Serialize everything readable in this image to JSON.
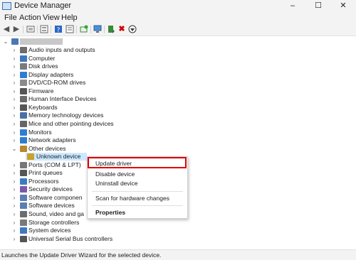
{
  "window": {
    "title": "Device Manager",
    "controls": {
      "minimize": "–",
      "maximize": "☐",
      "close": "✕"
    }
  },
  "menu": [
    "File",
    "Action",
    "View",
    "Help"
  ],
  "toolbar_icons": [
    "back-icon",
    "forward-icon",
    "properties-icon",
    "show-hidden-icon",
    "help-icon",
    "view-icon",
    "refresh-icon",
    "monitor-icon",
    "add-driver-icon",
    "uninstall-icon",
    "download-icon"
  ],
  "tree": {
    "root_label": "",
    "items": [
      {
        "label": "Audio inputs and outputs",
        "icon": "audio",
        "expanded": false
      },
      {
        "label": "Computer",
        "icon": "computer",
        "expanded": false
      },
      {
        "label": "Disk drives",
        "icon": "disk",
        "expanded": false
      },
      {
        "label": "Display adapters",
        "icon": "display",
        "expanded": false
      },
      {
        "label": "DVD/CD-ROM drives",
        "icon": "dvd",
        "expanded": false
      },
      {
        "label": "Firmware",
        "icon": "firmware",
        "expanded": false
      },
      {
        "label": "Human Interface Devices",
        "icon": "hid",
        "expanded": false
      },
      {
        "label": "Keyboards",
        "icon": "keyboard",
        "expanded": false
      },
      {
        "label": "Memory technology devices",
        "icon": "memory",
        "expanded": false
      },
      {
        "label": "Mice and other pointing devices",
        "icon": "mouse",
        "expanded": false
      },
      {
        "label": "Monitors",
        "icon": "monitor",
        "expanded": false
      },
      {
        "label": "Network adapters",
        "icon": "network",
        "expanded": false
      },
      {
        "label": "Other devices",
        "icon": "other",
        "expanded": true
      },
      {
        "label": "Unknown device",
        "icon": "unknown",
        "child": true,
        "selected": true
      },
      {
        "label": "Ports (COM & LPT)",
        "icon": "ports",
        "expanded": false
      },
      {
        "label": "Print queues",
        "icon": "print",
        "expanded": false
      },
      {
        "label": "Processors",
        "icon": "processor",
        "expanded": false
      },
      {
        "label": "Security devices",
        "icon": "security",
        "expanded": false
      },
      {
        "label": "Software componen",
        "icon": "software",
        "expanded": false
      },
      {
        "label": "Software devices",
        "icon": "software",
        "expanded": false
      },
      {
        "label": "Sound, video and ga",
        "icon": "sound",
        "expanded": false
      },
      {
        "label": "Storage controllers",
        "icon": "storage",
        "expanded": false
      },
      {
        "label": "System devices",
        "icon": "system",
        "expanded": false
      },
      {
        "label": "Universal Serial Bus controllers",
        "icon": "usb",
        "expanded": false
      }
    ]
  },
  "context_menu": {
    "update": "Update driver",
    "disable": "Disable device",
    "uninstall": "Uninstall device",
    "scan": "Scan for hardware changes",
    "properties": "Properties"
  },
  "status": {
    "text": "Launches the Update Driver Wizard for the selected device."
  }
}
